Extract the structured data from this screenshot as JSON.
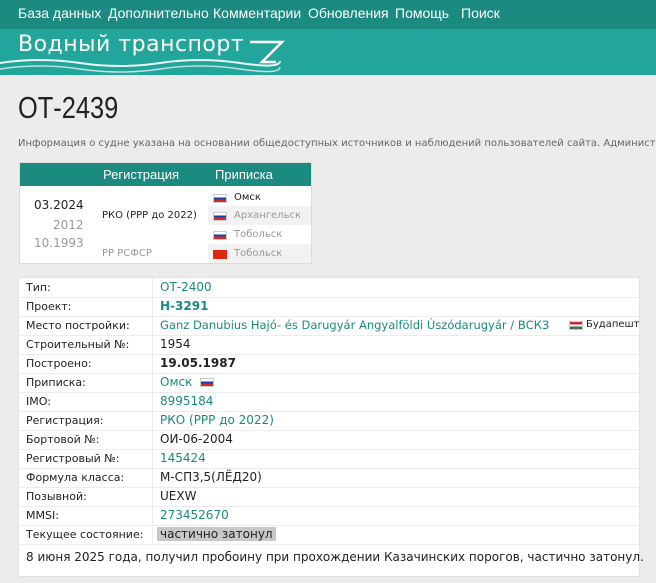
{
  "nav": [
    "База данных",
    "Дополнительно",
    "Комментарии",
    "Обновления",
    "Помощь",
    "Поиск"
  ],
  "banner_title": "Водный транспорт",
  "page_title": "ОТ-2439",
  "info_text": "Информация о судне указана на основании общедоступных источников и наблюдений пользователей сайта. Администрация",
  "registration": {
    "headers": {
      "registration": "Регистрация",
      "port": "Приписка"
    },
    "dates": [
      "03.2024",
      "2012",
      "10.1993"
    ],
    "registries": [
      "РКО (РРР до 2022)",
      "РР РСФСР"
    ],
    "ports": [
      {
        "name": "Омск",
        "flag": "ru",
        "active": true
      },
      {
        "name": "Архангельск",
        "flag": "ru",
        "active": false
      },
      {
        "name": "Тобольск",
        "flag": "ru",
        "active": false
      },
      {
        "name": "Тобольск",
        "flag": "cn",
        "active": false
      }
    ]
  },
  "details": [
    {
      "label": "Тип:",
      "value": "ОТ-2400",
      "style": "link"
    },
    {
      "label": "Проект:",
      "value": "Н-3291",
      "style": "link-bold"
    },
    {
      "label": "Место постройки:",
      "value": "Ganz Danubius Hajó- és Darugyár Angyalföldi Úszódarugyár / ВСКЗ",
      "style": "link",
      "extra": "Будапешт",
      "extra_flag": "hu"
    },
    {
      "label": "Строительный №:",
      "value": "1954",
      "style": "plain"
    },
    {
      "label": "Построено:",
      "value": "19.05.1987",
      "style": "bold"
    },
    {
      "label": "Приписка:",
      "value": "Омск",
      "style": "link",
      "flag": "ru"
    },
    {
      "label": "IMO:",
      "value": "8995184",
      "style": "link"
    },
    {
      "label": "Регистрация:",
      "value": "РКО (РРР до 2022)",
      "style": "link"
    },
    {
      "label": "Бортовой №:",
      "value": "ОИ-06-2004",
      "style": "plain"
    },
    {
      "label": "Регистровый №:",
      "value": "145424",
      "style": "link"
    },
    {
      "label": "Формула класса:",
      "value": "М-СП3,5(ЛЁД20)",
      "style": "plain"
    },
    {
      "label": "Позывной:",
      "value": "UEXW",
      "style": "plain"
    },
    {
      "label": "MMSI:",
      "value": "273452670",
      "style": "link"
    },
    {
      "label": "Текущее состояние:",
      "value": "частично затонул",
      "style": "status"
    }
  ],
  "note": "8 июня 2025 года, получил пробоину при прохождении Казачинских порогов, частично затонул."
}
